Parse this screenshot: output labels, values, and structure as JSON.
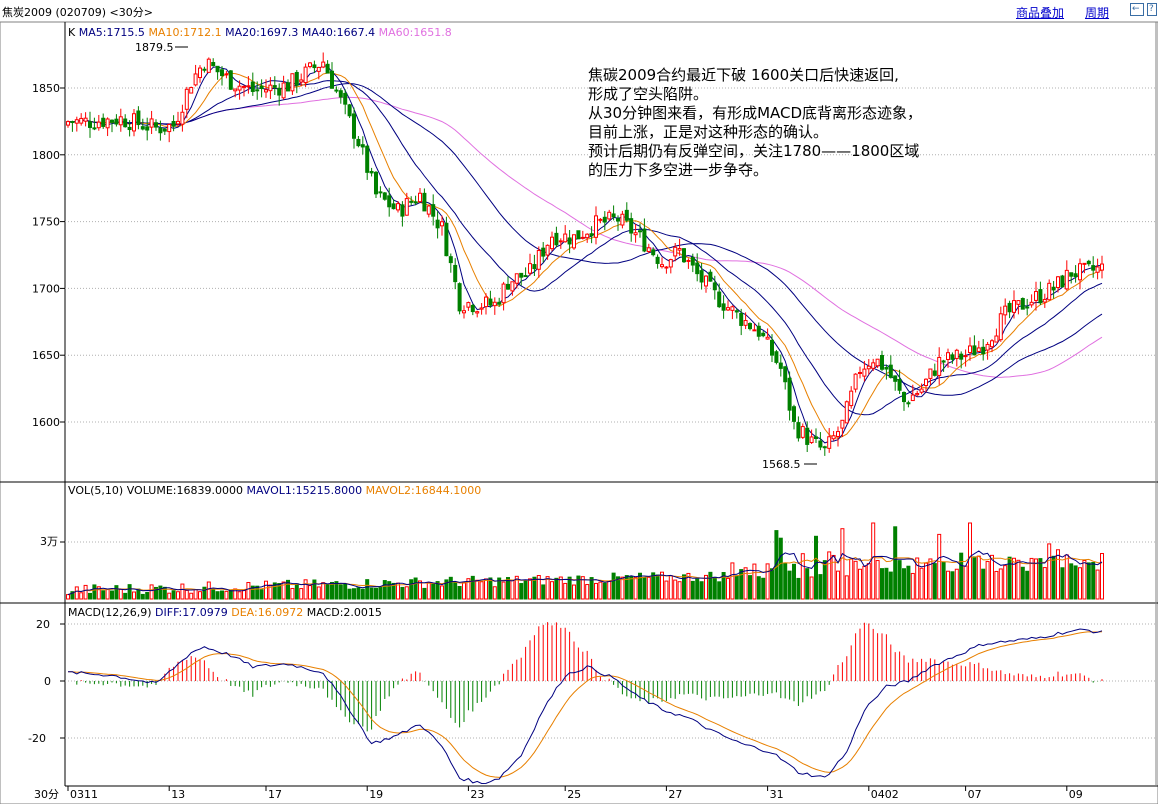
{
  "header": {
    "title": "焦炭2009 (020709) <30分>",
    "overlay_button": "商品叠加",
    "period_button": "周期",
    "back_icon": "arrow-left-icon",
    "help_icon": "help-icon"
  },
  "price_panel": {
    "legend": [
      {
        "label": "K",
        "color": "#000000"
      },
      {
        "label": "MA5:1715.5",
        "color": "#000080"
      },
      {
        "label": "MA10:1712.1",
        "color": "#e88000"
      },
      {
        "label": "MA20:1697.3",
        "color": "#000080"
      },
      {
        "label": "MA40:1667.4",
        "color": "#000080"
      },
      {
        "label": "MA60:1651.8",
        "color": "#e070e0"
      }
    ],
    "y_ticks": [
      "1850",
      "1800",
      "1750",
      "1700",
      "1650",
      "1600"
    ],
    "high_label": "1879.5",
    "low_label": "1568.5",
    "annotation": [
      "焦碳2009合约最近下破 1600关口后快速返回,",
      "形成了空头陷阱。",
      "从30分钟图来看，有形成MACD底背离形态迹象，",
      "目前上涨，正是对这种形态的确认。",
      "预计后期仍有反弹空间，关注1780——1800区域",
      "的压力下多空进一步争夺。"
    ]
  },
  "volume_panel": {
    "legend": [
      {
        "label": "VOL(5,10)",
        "color": "#000000"
      },
      {
        "label": "VOLUME:16839.0000",
        "color": "#000000"
      },
      {
        "label": "MAVOL1:15215.8000",
        "color": "#000080"
      },
      {
        "label": "MAVOL2:16844.1000",
        "color": "#e88000"
      }
    ],
    "y_tick": "3万"
  },
  "macd_panel": {
    "legend": [
      {
        "label": "MACD(12,26,9)",
        "color": "#000000"
      },
      {
        "label": "DIFF:17.0979",
        "color": "#000080"
      },
      {
        "label": "DEA:16.0972",
        "color": "#e88000"
      },
      {
        "label": "MACD:2.0015",
        "color": "#000000"
      }
    ],
    "y_ticks": [
      "20",
      "0",
      "-20"
    ]
  },
  "x_axis": {
    "period_label": "30分",
    "dates": [
      "0311",
      "13",
      "17",
      "19",
      "23",
      "25",
      "27",
      "31",
      "0402",
      "07",
      "09"
    ]
  },
  "colors": {
    "up": "#ff0000",
    "down": "#008000",
    "ma_navy": "#000080",
    "ma_orange": "#e88000",
    "ma_pink": "#e070e0",
    "grid": "#b0b0b0"
  },
  "chart_data": {
    "type": "candlestick",
    "price_range": [
      1568.5,
      1879.5
    ],
    "price_anchor_points": [
      [
        0,
        1825
      ],
      [
        5,
        1825
      ],
      [
        12,
        1827
      ],
      [
        20,
        1820
      ],
      [
        24,
        1822
      ],
      [
        28,
        1855
      ],
      [
        31,
        1870
      ],
      [
        37,
        1855
      ],
      [
        42,
        1848
      ],
      [
        50,
        1852
      ],
      [
        58,
        1870
      ],
      [
        62,
        1840
      ],
      [
        66,
        1810
      ],
      [
        70,
        1770
      ],
      [
        75,
        1758
      ],
      [
        80,
        1770
      ],
      [
        85,
        1745
      ],
      [
        89,
        1690
      ],
      [
        93,
        1688
      ],
      [
        97,
        1688
      ],
      [
        100,
        1705
      ],
      [
        105,
        1712
      ],
      [
        110,
        1740
      ],
      [
        115,
        1738
      ],
      [
        120,
        1748
      ],
      [
        125,
        1752
      ],
      [
        130,
        1738
      ],
      [
        135,
        1720
      ],
      [
        139,
        1728
      ],
      [
        143,
        1710
      ],
      [
        147,
        1695
      ],
      [
        152,
        1680
      ],
      [
        157,
        1668
      ],
      [
        162,
        1640
      ],
      [
        165,
        1598
      ],
      [
        169,
        1585
      ],
      [
        172,
        1578
      ],
      [
        176,
        1598
      ],
      [
        180,
        1640
      ],
      [
        183,
        1648
      ],
      [
        186,
        1640
      ],
      [
        190,
        1615
      ],
      [
        194,
        1625
      ],
      [
        198,
        1645
      ],
      [
        204,
        1650
      ],
      [
        208,
        1658
      ],
      [
        213,
        1680
      ],
      [
        218,
        1690
      ],
      [
        224,
        1700
      ],
      [
        228,
        1712
      ],
      [
        231,
        1712
      ],
      [
        235,
        1715
      ]
    ],
    "macd_anchor_points": [
      [
        0,
        3
      ],
      [
        10,
        2
      ],
      [
        20,
        -1
      ],
      [
        28,
        10
      ],
      [
        31,
        12
      ],
      [
        37,
        9
      ],
      [
        42,
        5
      ],
      [
        50,
        6
      ],
      [
        58,
        3
      ],
      [
        64,
        -10
      ],
      [
        69,
        -22
      ],
      [
        75,
        -19
      ],
      [
        80,
        -15
      ],
      [
        85,
        -23
      ],
      [
        89,
        -34
      ],
      [
        94,
        -36
      ],
      [
        98,
        -34
      ],
      [
        103,
        -26
      ],
      [
        108,
        -10
      ],
      [
        113,
        2
      ],
      [
        118,
        5
      ],
      [
        124,
        1
      ],
      [
        129,
        -5
      ],
      [
        135,
        -10
      ],
      [
        141,
        -13
      ],
      [
        147,
        -18
      ],
      [
        153,
        -22
      ],
      [
        160,
        -25
      ],
      [
        166,
        -32
      ],
      [
        172,
        -34
      ],
      [
        177,
        -25
      ],
      [
        181,
        -10
      ],
      [
        186,
        -2
      ],
      [
        191,
        0
      ],
      [
        196,
        5
      ],
      [
        202,
        9
      ],
      [
        208,
        13
      ],
      [
        214,
        14
      ],
      [
        220,
        15
      ],
      [
        226,
        17
      ],
      [
        231,
        18
      ],
      [
        235,
        17
      ]
    ],
    "volume_peak_bars": [
      [
        161,
        36000
      ],
      [
        162,
        32000
      ],
      [
        170,
        33000
      ],
      [
        176,
        37000
      ],
      [
        183,
        40000
      ],
      [
        188,
        38000
      ],
      [
        198,
        34000
      ],
      [
        205,
        40000
      ],
      [
        214,
        22000
      ],
      [
        223,
        29000
      ],
      [
        232,
        19000
      ]
    ]
  }
}
